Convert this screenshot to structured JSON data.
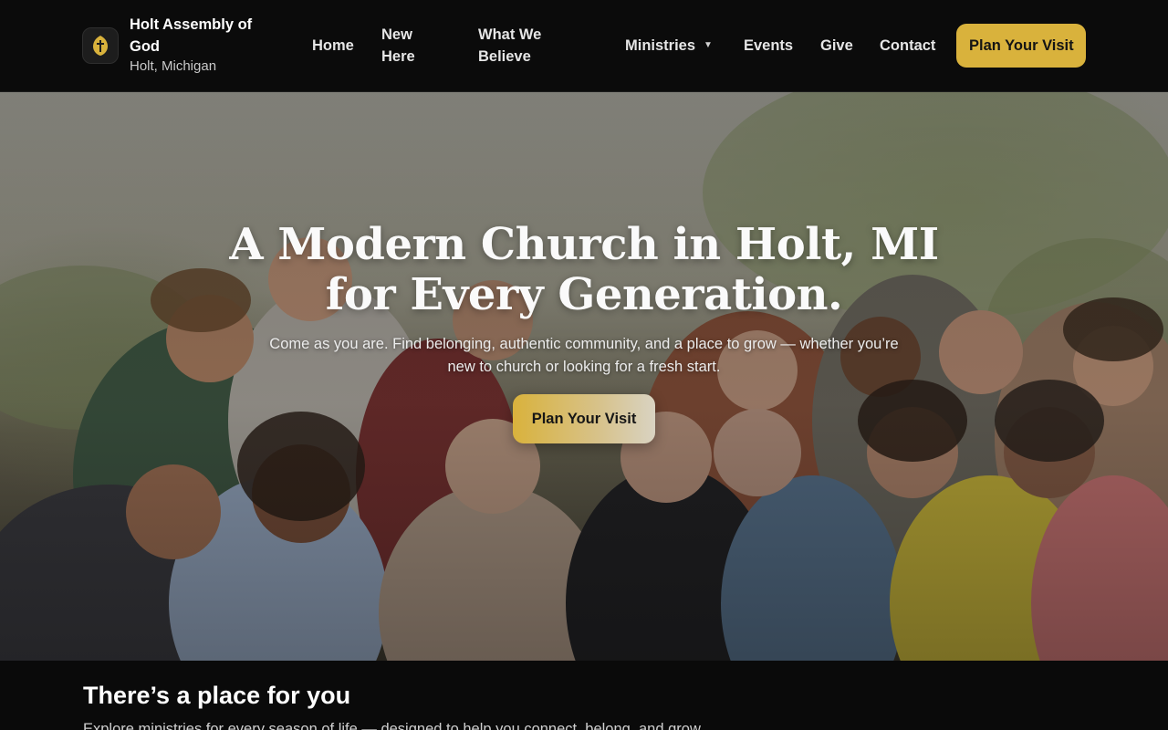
{
  "header": {
    "brand_name": "Holt Assembly of God",
    "brand_location": "Holt, Michigan",
    "logo_icon": "cross-icon",
    "nav": {
      "home": "Home",
      "new_here": "New Here",
      "what_we_believe": "What We Believe",
      "ministries": "Ministries",
      "events": "Events",
      "give": "Give",
      "contact": "Contact"
    },
    "cta": "Plan Your Visit"
  },
  "hero": {
    "title": "A Modern Church in Holt, MI for Every Generation.",
    "subtitle": "Come as you are. Find belonging, authentic community, and a place to grow — whether you’re new to church or looking for a fresh start.",
    "cta": "Plan Your Visit"
  },
  "section": {
    "title": "There’s a place for you",
    "subtitle": "Explore ministries for every season of life — designed to help you connect, belong, and grow."
  },
  "colors": {
    "accent": "#d9b23c",
    "background": "#0a0a0a"
  }
}
